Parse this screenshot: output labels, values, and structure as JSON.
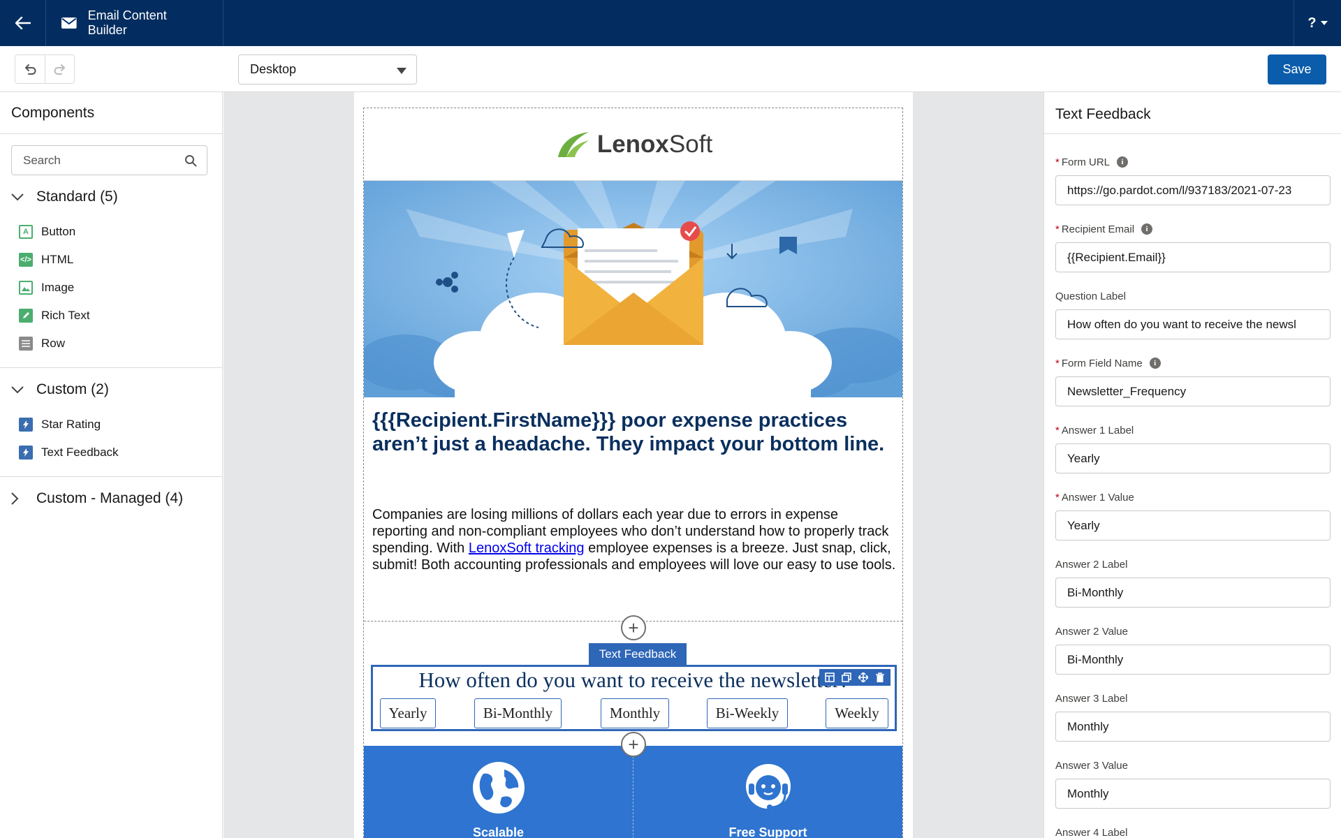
{
  "app": {
    "title": "Email Content Builder",
    "help_label": "?"
  },
  "toolbar": {
    "device_value": "Desktop",
    "save_label": "Save"
  },
  "left_panel": {
    "title": "Components",
    "search_placeholder": "Search",
    "sections": [
      {
        "label": "Standard (5)",
        "expanded": true,
        "items": [
          "Button",
          "HTML",
          "Image",
          "Rich Text",
          "Row"
        ]
      },
      {
        "label": "Custom (2)",
        "expanded": true,
        "items": [
          "Star Rating",
          "Text Feedback"
        ]
      },
      {
        "label": "Custom - Managed (4)",
        "expanded": false,
        "items": []
      }
    ]
  },
  "email": {
    "logo_bold": "Lenox",
    "logo_light": "Soft",
    "headline": "{{{Recipient.FirstName}}} poor expense practices aren’t just a headache. They impact your bottom line.",
    "body_before": "Companies are losing millions of dollars each year due to errors in expense reporting and non-compliant employees who don’t understand how to properly track spending. With ",
    "body_link": "LenoxSoft tracking",
    "body_after": " employee expenses is a breeze. Just snap, click, submit! Both accounting professionals and employees will love our easy to use tools.",
    "selected_component_tag": "Text Feedback",
    "feedback_question": "How often do you want to receive the newsletter?",
    "feedback_answers": [
      "Yearly",
      "Bi-Monthly",
      "Monthly",
      "Bi-Weekly",
      "Weekly"
    ],
    "feature_labels": [
      "Scalable",
      "Free Support"
    ]
  },
  "right_panel": {
    "title": "Text Feedback",
    "fields": [
      {
        "label": "Form URL",
        "required": true,
        "info": true,
        "value": "https://go.pardot.com/l/937183/2021-07-23"
      },
      {
        "label": "Recipient Email",
        "required": true,
        "info": true,
        "value": "{{Recipient.Email}}"
      },
      {
        "label": "Question Label",
        "required": false,
        "info": false,
        "value": "How often do you want to receive the newsl"
      },
      {
        "label": "Form Field Name",
        "required": true,
        "info": true,
        "value": "Newsletter_Frequency"
      },
      {
        "label": "Answer 1 Label",
        "required": true,
        "info": false,
        "value": "Yearly"
      },
      {
        "label": "Answer 1 Value",
        "required": true,
        "info": false,
        "value": "Yearly"
      },
      {
        "label": "Answer 2 Label",
        "required": false,
        "info": false,
        "value": "Bi-Monthly"
      },
      {
        "label": "Answer 2 Value",
        "required": false,
        "info": false,
        "value": "Bi-Monthly"
      },
      {
        "label": "Answer 3 Label",
        "required": false,
        "info": false,
        "value": "Monthly"
      },
      {
        "label": "Answer 3 Value",
        "required": false,
        "info": false,
        "value": "Monthly"
      },
      {
        "label": "Answer 4 Label",
        "required": false,
        "info": false,
        "value": ""
      }
    ]
  },
  "colors": {
    "header_bg": "#032d60",
    "save_button": "#0b5cab",
    "selection_blue": "#2e66b8",
    "feature_row": "#2e74d0",
    "headline": "#0a2f5e",
    "hero_sky": "#6ba9e0"
  },
  "icons": {
    "back": "arrow-left-icon",
    "email": "envelope-icon",
    "undo": "undo-icon",
    "redo": "redo-icon",
    "search": "search-icon",
    "add": "plus-circle-icon",
    "info": "info-icon"
  }
}
